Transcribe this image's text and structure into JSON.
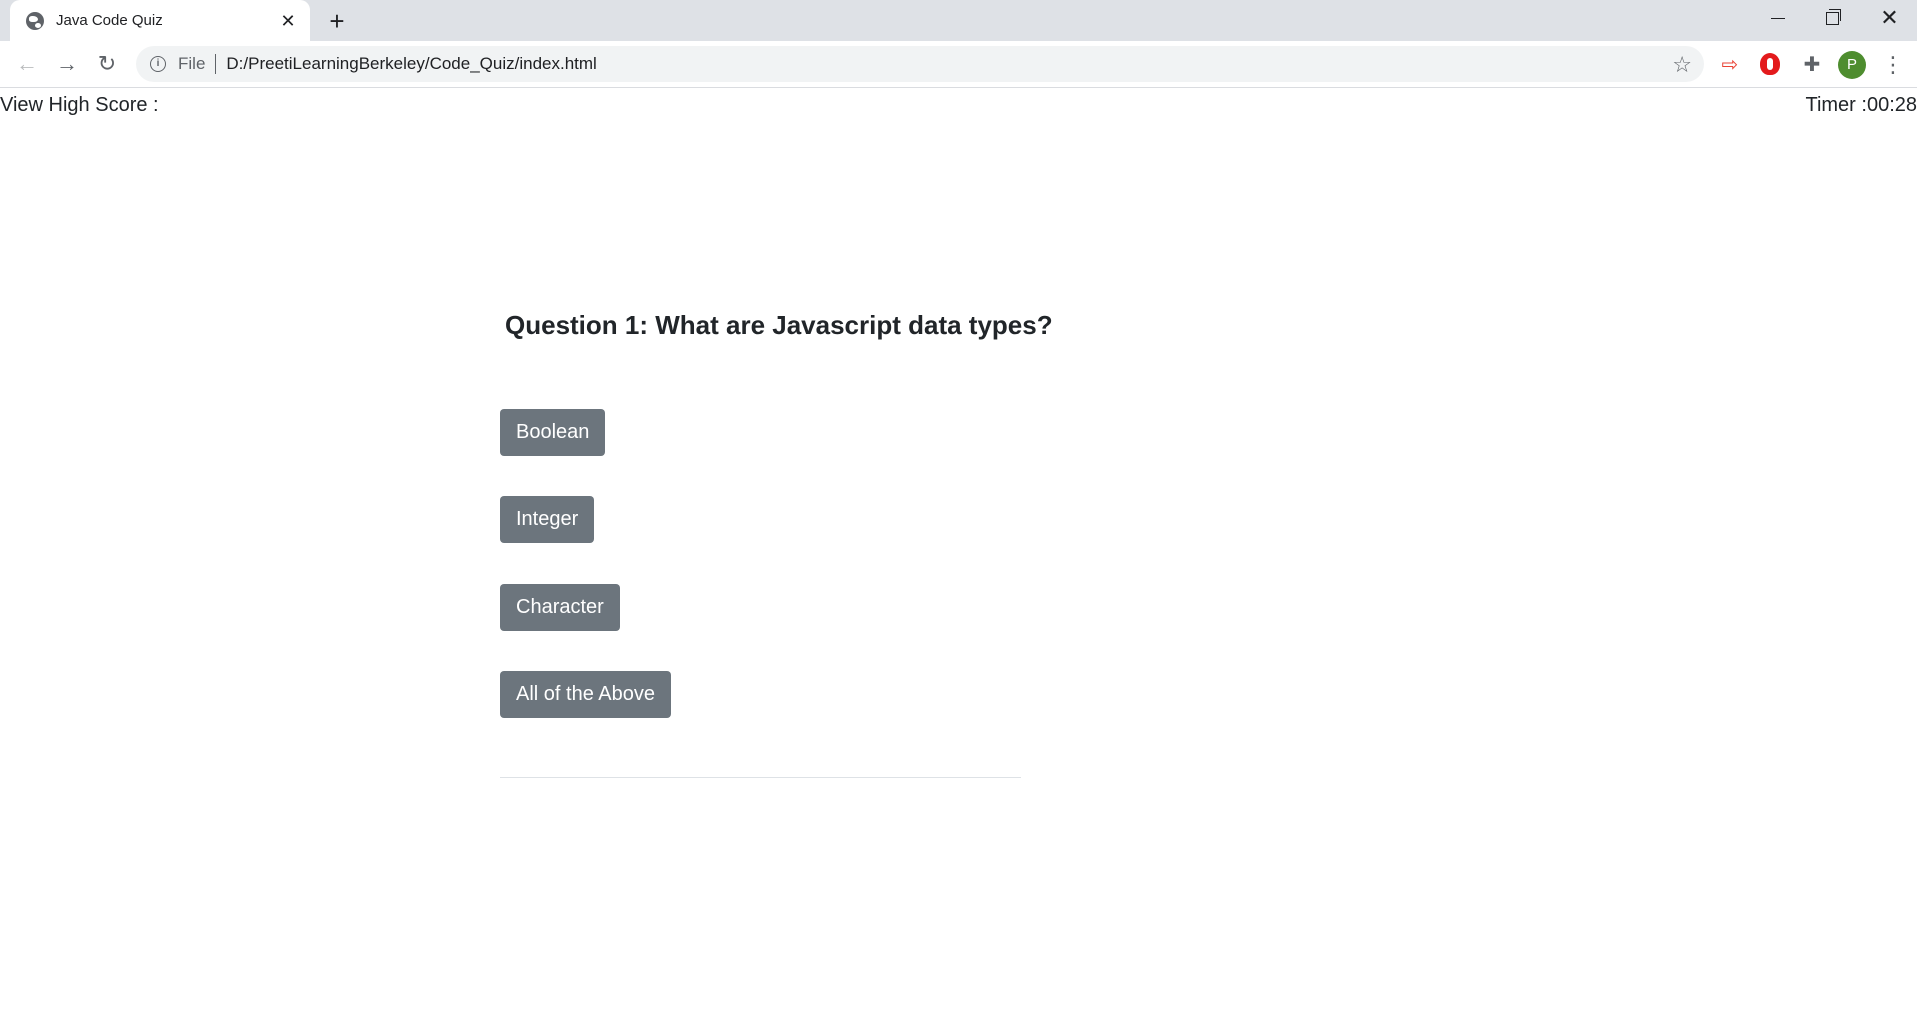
{
  "browser": {
    "tab_title": "Java Code Quiz",
    "address_scheme": "File",
    "address_url": "D:/PreetiLearningBerkeley/Code_Quiz/index.html",
    "profile_initial": "P"
  },
  "page": {
    "high_score_label": "View High Score :",
    "timer_text": "Timer :00:28",
    "question": "Question 1: What are Javascript data types?",
    "answers": [
      "Boolean",
      "Integer",
      "Character",
      "All of the Above"
    ]
  },
  "colors": {
    "button_bg": "#6c757d",
    "button_text": "#ffffff",
    "text": "#212529"
  }
}
